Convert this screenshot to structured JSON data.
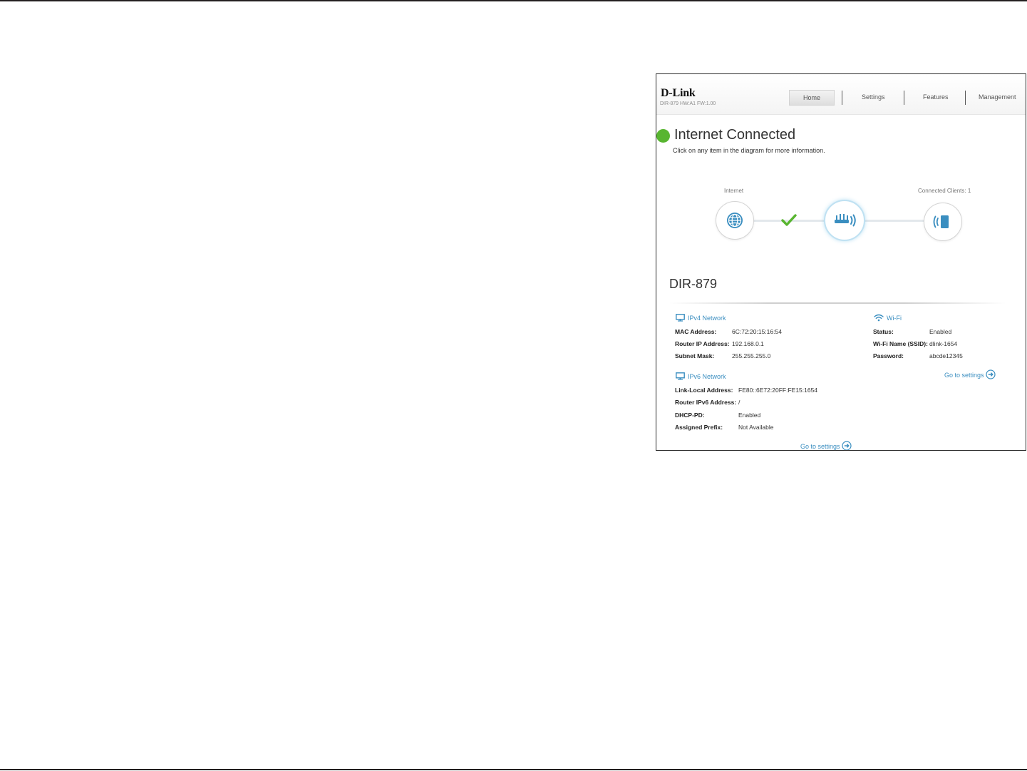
{
  "header": {
    "logo": "D-Link",
    "firmware": "DIR-879 HW:A1 FW:1.00",
    "nav": [
      {
        "label": "Home"
      },
      {
        "label": "Settings"
      },
      {
        "label": "Features"
      },
      {
        "label": "Management"
      }
    ]
  },
  "status": {
    "title": "Internet Connected",
    "subtitle": "Click on any item in the diagram for more information.",
    "color": "#58b530"
  },
  "diagram": {
    "internet_label": "Internet",
    "clients_label": "Connected Clients: 1",
    "icons": [
      "globe-icon",
      "checkmark-icon",
      "router-icon",
      "client-device-icon"
    ]
  },
  "device": {
    "name": "DIR-879",
    "ipv4": {
      "heading": "IPv4 Network",
      "rows": [
        {
          "label": "MAC Address:",
          "value": "6C:72:20:15:16:54"
        },
        {
          "label": "Router IP Address:",
          "value": "192.168.0.1"
        },
        {
          "label": "Subnet Mask:",
          "value": "255.255.255.0"
        }
      ]
    },
    "ipv6": {
      "heading": "IPv6 Network",
      "rows": [
        {
          "label": "Link-Local Address:",
          "value": "FE80::6E72:20FF:FE15:1654"
        },
        {
          "label": "Router IPv6 Address:",
          "value": "/"
        },
        {
          "label": "DHCP-PD:",
          "value": "Enabled"
        },
        {
          "label": "Assigned Prefix:",
          "value": "Not Available"
        }
      ],
      "goto": "Go to settings"
    },
    "wifi": {
      "heading": "Wi-Fi",
      "rows": [
        {
          "label": "Status:",
          "value": "Enabled"
        },
        {
          "label": "Wi-Fi Name (SSID):",
          "value": "dlink-1654"
        },
        {
          "label": "Password:",
          "value": "abcde12345"
        }
      ],
      "goto": "Go to settings"
    }
  },
  "colors": {
    "accent": "#3a8ec0",
    "status_green": "#58b530"
  }
}
